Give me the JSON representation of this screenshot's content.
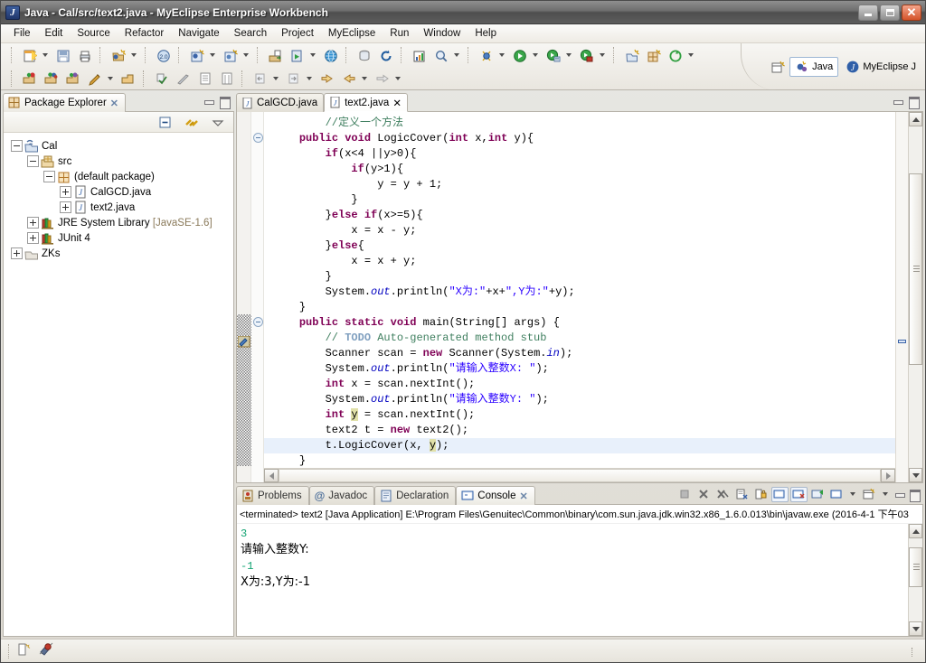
{
  "window": {
    "title": "Java - Cal/src/text2.java - MyEclipse Enterprise Workbench",
    "app_icon": "java-eclipse-icon",
    "minimize_label": "Minimize",
    "maximize_label": "Restore",
    "close_label": "Close"
  },
  "menubar": {
    "items": [
      {
        "label": "File"
      },
      {
        "label": "Edit"
      },
      {
        "label": "Source"
      },
      {
        "label": "Refactor"
      },
      {
        "label": "Navigate"
      },
      {
        "label": "Search"
      },
      {
        "label": "Project"
      },
      {
        "label": "MyEclipse"
      },
      {
        "label": "Run"
      },
      {
        "label": "Window"
      },
      {
        "label": "Help"
      }
    ]
  },
  "perspective": {
    "open_perspective_label": "Open Perspective",
    "tabs": [
      {
        "label": "Java",
        "active": true
      },
      {
        "label": "MyEclipse J",
        "active": false
      }
    ]
  },
  "package_explorer": {
    "tab_label": "Package Explorer",
    "tab_icon": "package-explorer-icon",
    "close_icon": "✕",
    "toolbar": [
      {
        "name": "collapse-all-icon"
      },
      {
        "name": "link-with-editor-icon"
      },
      {
        "name": "view-menu-icon"
      }
    ],
    "tree": [
      {
        "label": "Cal",
        "indent": 0,
        "expander": "minus",
        "icon": "java-project-icon"
      },
      {
        "label": "src",
        "indent": 1,
        "expander": "minus",
        "icon": "source-folder-icon"
      },
      {
        "label": "(default package)",
        "indent": 2,
        "expander": "minus",
        "icon": "package-icon"
      },
      {
        "label": "CalGCD.java",
        "indent": 3,
        "expander": "plus",
        "icon": "java-file-icon"
      },
      {
        "label": "text2.java",
        "indent": 3,
        "expander": "plus",
        "icon": "java-file-icon"
      },
      {
        "label": "JRE System Library",
        "suffix": "[JavaSE-1.6]",
        "indent": 1,
        "expander": "plus",
        "icon": "library-icon"
      },
      {
        "label": "JUnit 4",
        "indent": 1,
        "expander": "plus",
        "icon": "library-icon"
      },
      {
        "label": "ZKs",
        "indent": 0,
        "expander": "plus",
        "icon": "closed-project-icon"
      }
    ]
  },
  "editor": {
    "tabs": [
      {
        "label": "CalGCD.java",
        "active": false,
        "icon": "java-file-icon"
      },
      {
        "label": "text2.java",
        "active": true,
        "icon": "java-file-icon",
        "close_icon": "✕"
      }
    ],
    "code_lines": [
      {
        "indent": 2,
        "highlight": false,
        "tokens": [
          {
            "t": "//定义一个方法",
            "c": "cmt"
          }
        ]
      },
      {
        "indent": 1,
        "highlight": false,
        "fold": true,
        "tokens": [
          {
            "t": "public ",
            "c": "kw"
          },
          {
            "t": "void ",
            "c": "kw"
          },
          {
            "t": "LogicCover(",
            "c": ""
          },
          {
            "t": "int",
            "c": "kw"
          },
          {
            "t": " x,",
            "c": ""
          },
          {
            "t": "int",
            "c": "kw"
          },
          {
            "t": " y){",
            "c": ""
          }
        ]
      },
      {
        "indent": 2,
        "highlight": false,
        "tokens": [
          {
            "t": "if",
            "c": "kw"
          },
          {
            "t": "(x<4 ||y>0){",
            "c": ""
          }
        ]
      },
      {
        "indent": 3,
        "highlight": false,
        "tokens": [
          {
            "t": "if",
            "c": "kw"
          },
          {
            "t": "(y>1){",
            "c": ""
          }
        ]
      },
      {
        "indent": 4,
        "highlight": false,
        "tokens": [
          {
            "t": "y = y + 1;",
            "c": ""
          }
        ]
      },
      {
        "indent": 3,
        "highlight": false,
        "tokens": [
          {
            "t": "}",
            "c": ""
          }
        ]
      },
      {
        "indent": 2,
        "highlight": false,
        "tokens": [
          {
            "t": "}",
            "c": ""
          },
          {
            "t": "else ",
            "c": "kw"
          },
          {
            "t": "if",
            "c": "kw"
          },
          {
            "t": "(x>=5){",
            "c": ""
          }
        ]
      },
      {
        "indent": 3,
        "highlight": false,
        "tokens": [
          {
            "t": "x = x - y;",
            "c": ""
          }
        ]
      },
      {
        "indent": 2,
        "highlight": false,
        "tokens": [
          {
            "t": "}",
            "c": ""
          },
          {
            "t": "else",
            "c": "kw"
          },
          {
            "t": "{",
            "c": ""
          }
        ]
      },
      {
        "indent": 3,
        "highlight": false,
        "tokens": [
          {
            "t": "x = x + y;",
            "c": ""
          }
        ]
      },
      {
        "indent": 2,
        "highlight": false,
        "tokens": [
          {
            "t": "}",
            "c": ""
          }
        ]
      },
      {
        "indent": 2,
        "highlight": false,
        "tokens": [
          {
            "t": "System.",
            "c": ""
          },
          {
            "t": "out",
            "c": "fld"
          },
          {
            "t": ".println(",
            "c": ""
          },
          {
            "t": "\"X为:\"",
            "c": "str"
          },
          {
            "t": "+x+",
            "c": ""
          },
          {
            "t": "\",Y为:\"",
            "c": "str"
          },
          {
            "t": "+y);",
            "c": ""
          }
        ]
      },
      {
        "indent": 1,
        "highlight": false,
        "tokens": [
          {
            "t": "}",
            "c": ""
          }
        ]
      },
      {
        "indent": 1,
        "highlight": false,
        "fold": true,
        "tokens": [
          {
            "t": "public ",
            "c": "kw"
          },
          {
            "t": "static ",
            "c": "kw"
          },
          {
            "t": "void ",
            "c": "kw"
          },
          {
            "t": "main(String[] args) {",
            "c": ""
          }
        ]
      },
      {
        "indent": 2,
        "highlight": false,
        "tokens": [
          {
            "t": "// ",
            "c": "cmt"
          },
          {
            "t": "TODO",
            "c": "todo"
          },
          {
            "t": " Auto-generated method stub",
            "c": "cmt"
          }
        ]
      },
      {
        "indent": 2,
        "highlight": false,
        "tokens": [
          {
            "t": "Scanner scan = ",
            "c": ""
          },
          {
            "t": "new",
            "c": "kw"
          },
          {
            "t": " Scanner(System.",
            "c": ""
          },
          {
            "t": "in",
            "c": "fld"
          },
          {
            "t": ");",
            "c": ""
          }
        ]
      },
      {
        "indent": 2,
        "highlight": false,
        "tokens": [
          {
            "t": "System.",
            "c": ""
          },
          {
            "t": "out",
            "c": "fld"
          },
          {
            "t": ".println(",
            "c": ""
          },
          {
            "t": "\"请输入整数X: \"",
            "c": "str"
          },
          {
            "t": ");",
            "c": ""
          }
        ]
      },
      {
        "indent": 2,
        "highlight": false,
        "tokens": [
          {
            "t": "int",
            "c": "kw"
          },
          {
            "t": " x = scan.nextInt();",
            "c": ""
          }
        ]
      },
      {
        "indent": 2,
        "highlight": false,
        "tokens": [
          {
            "t": "System.",
            "c": ""
          },
          {
            "t": "out",
            "c": "fld"
          },
          {
            "t": ".println(",
            "c": ""
          },
          {
            "t": "\"请输入整数Y: \"",
            "c": "str"
          },
          {
            "t": ");",
            "c": ""
          }
        ]
      },
      {
        "indent": 2,
        "highlight": false,
        "tokens": [
          {
            "t": "int",
            "c": "kw"
          },
          {
            "t": " ",
            "c": ""
          },
          {
            "t": "y",
            "c": "occ"
          },
          {
            "t": " = scan.nextInt();",
            "c": ""
          }
        ]
      },
      {
        "indent": 2,
        "highlight": false,
        "tokens": [
          {
            "t": "text2 t = ",
            "c": ""
          },
          {
            "t": "new",
            "c": "kw"
          },
          {
            "t": " text2();",
            "c": ""
          }
        ]
      },
      {
        "indent": 2,
        "highlight": true,
        "tokens": [
          {
            "t": "t.LogicCover(x, ",
            "c": ""
          },
          {
            "t": "y",
            "c": "occ"
          },
          {
            "t": ");",
            "c": ""
          }
        ]
      },
      {
        "indent": 1,
        "highlight": false,
        "tokens": [
          {
            "t": "}",
            "c": ""
          }
        ]
      }
    ]
  },
  "bottom_panel": {
    "tabs": [
      {
        "label": "Problems",
        "icon": "problems-icon",
        "active": false
      },
      {
        "label": "Javadoc",
        "icon": "javadoc-icon",
        "active": false
      },
      {
        "label": "Declaration",
        "icon": "declaration-icon",
        "active": false
      },
      {
        "label": "Console",
        "icon": "console-icon",
        "active": true,
        "close_icon": "✕"
      }
    ],
    "toolbar": [
      {
        "name": "terminate-icon"
      },
      {
        "name": "remove-launch-icon"
      },
      {
        "name": "remove-all-terminated-icon"
      },
      {
        "name": "clear-console-icon"
      },
      {
        "name": "scroll-lock-icon"
      },
      {
        "name": "show-console-on-output-icon",
        "pressed": true
      },
      {
        "name": "show-console-on-error-icon",
        "pressed": true
      },
      {
        "name": "pin-console-icon"
      },
      {
        "name": "display-selected-console-icon"
      },
      {
        "name": "open-console-icon"
      }
    ],
    "console_header": "<terminated> text2 [Java Application] E:\\Program Files\\Genuitec\\Common\\binary\\com.sun.java.jdk.win32.x86_1.6.0.013\\bin\\javaw.exe (2016-4-1 下午03",
    "console_output": [
      {
        "text": "3",
        "kind": "input"
      },
      {
        "text": "请输入整数Y:",
        "kind": "output"
      },
      {
        "text": "-1",
        "kind": "input"
      },
      {
        "text": "X为:3,Y为:-1",
        "kind": "output"
      }
    ]
  },
  "statusbar": {
    "items": [
      {
        "name": "writable-indicator-icon"
      },
      {
        "name": "myeclipse-status-icon"
      }
    ]
  },
  "colors": {
    "keyword": "#7f0055",
    "string": "#2a00ff",
    "comment": "#3f7f5f",
    "todo": "#7f9fbf",
    "field": "#0000c0",
    "occurrence_highlight": "#e0e0a8",
    "current_line": "#e8f0fb",
    "console_input": "#12a372",
    "title_bar": "#5d5d5d"
  }
}
